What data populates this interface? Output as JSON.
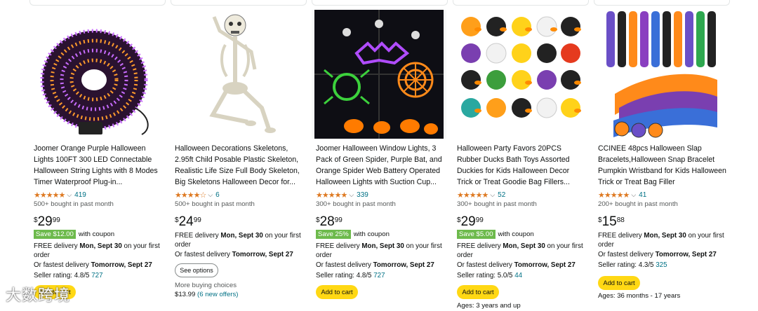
{
  "products": [
    {
      "title": "Joomer Orange Purple Halloween Lights 100FT 300 LED Connectable Halloween String Lights with 8 Modes Timer Waterproof Plug-in...",
      "stars": "★★★★★",
      "rating_count": "419",
      "bought": "500+ bought in past month",
      "price_symbol": "$",
      "price_whole": "29",
      "price_fraction": "99",
      "coupon_badge": "Save $12.00",
      "coupon_label": "with coupon",
      "delivery_prefix": "FREE delivery ",
      "delivery_date": "Mon, Sept 30",
      "delivery_suffix": " on your first order",
      "fastest_prefix": "Or fastest delivery ",
      "fastest_date": "Tomorrow, Sept 27",
      "seller_label": "Seller rating: 4.8/5 ",
      "seller_count": "727",
      "cart_label": "Add to cart"
    },
    {
      "title": "Halloween Decorations Skeletons, 2.95ft Child Posable Plastic Skeleton, Realistic Life Size Full Body Skeleton, Big Skeletons Halloween Decor for...",
      "stars": "★★★★☆",
      "rating_count": "6",
      "bought": "500+ bought in past month",
      "price_symbol": "$",
      "price_whole": "24",
      "price_fraction": "99",
      "delivery_prefix": "FREE delivery ",
      "delivery_date": "Mon, Sept 30",
      "delivery_suffix": " on your first order",
      "fastest_prefix": "Or fastest delivery ",
      "fastest_date": "Tomorrow, Sept 27",
      "options_label": "See options",
      "more_choices": "More buying choices",
      "more_price": "$13.99",
      "more_offers": "(6 new offers)"
    },
    {
      "title": "Joomer Halloween Window Lights, 3 Pack of Green Spider, Purple Bat, and Orange Spider Web Battery Operated Halloween Lights with Suction Cup...",
      "stars": "★★★★★",
      "rating_count": "339",
      "bought": "300+ bought in past month",
      "price_symbol": "$",
      "price_whole": "28",
      "price_fraction": "99",
      "coupon_badge": "Save 25%",
      "coupon_label": "with coupon",
      "delivery_prefix": "FREE delivery ",
      "delivery_date": "Mon, Sept 30",
      "delivery_suffix": " on your first order",
      "fastest_prefix": "Or fastest delivery ",
      "fastest_date": "Tomorrow, Sept 27",
      "seller_label": "Seller rating: 4.8/5 ",
      "seller_count": "727",
      "cart_label": "Add to cart"
    },
    {
      "title": "Halloween Party Favors 20PCS Rubber Ducks Bath Toys Assorted Duckies for Kids Halloween Decor Trick or Treat Goodie Bag Fillers...",
      "stars": "★★★★★",
      "rating_count": "52",
      "bought": "300+ bought in past month",
      "price_symbol": "$",
      "price_whole": "29",
      "price_fraction": "99",
      "coupon_badge": "Save $5.00",
      "coupon_label": "with coupon",
      "delivery_prefix": "FREE delivery ",
      "delivery_date": "Mon, Sept 30",
      "delivery_suffix": " on your first order",
      "fastest_prefix": "Or fastest delivery ",
      "fastest_date": "Tomorrow, Sept 27",
      "seller_label": "Seller rating: 5.0/5 ",
      "seller_count": "44",
      "cart_label": "Add to cart",
      "ages": "Ages: 3 years and up"
    },
    {
      "title": "CCINEE 48pcs Halloween Slap Bracelets,Halloween Snap Bracelet Pumpkin Wristband for Kids Halloween Trick or Treat Bag Filler",
      "stars": "★★★★★",
      "rating_count": "41",
      "bought": "200+ bought in past month",
      "price_symbol": "$",
      "price_whole": "15",
      "price_fraction": "88",
      "delivery_prefix": "FREE delivery ",
      "delivery_date": "Mon, Sept 30",
      "delivery_suffix": " on your first order",
      "fastest_prefix": "Or fastest delivery ",
      "fastest_date": "Tomorrow, Sept 27",
      "seller_label": "Seller rating: 4.3/5 ",
      "seller_count": "325",
      "cart_label": "Add to cart",
      "ages": "Ages: 36 months - 17 years"
    }
  ],
  "watermark": "大数跨境",
  "colors": {
    "star": "#de7921",
    "link": "#007185",
    "coupon": "#6dba4c",
    "cart": "#ffd814"
  }
}
